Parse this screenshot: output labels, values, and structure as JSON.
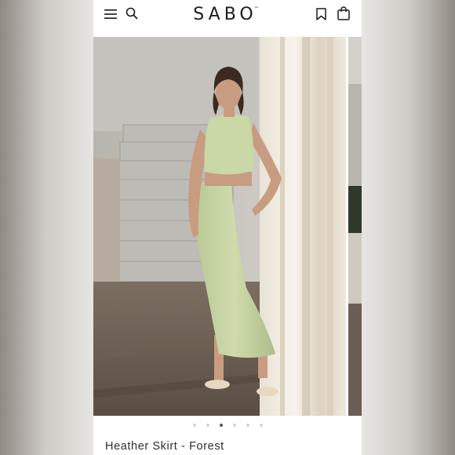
{
  "header": {
    "brand": "SABO",
    "trademark": "™",
    "icons": [
      "menu-icon",
      "search-icon",
      "bookmark-icon",
      "bag-icon"
    ]
  },
  "gallery": {
    "slide_count": 6,
    "active_index": 2
  },
  "product": {
    "title": "Heather Skirt - Forest"
  },
  "colors": {
    "background": "#ffffff",
    "text": "#1c1c1c",
    "dot_inactive": "#d6d6d6",
    "dot_active": "#555555"
  }
}
